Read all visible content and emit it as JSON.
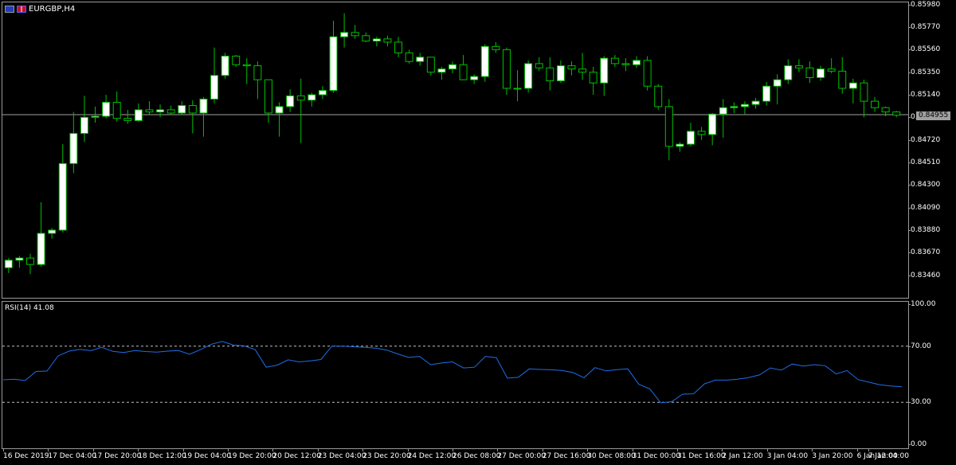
{
  "header": {
    "symbol_label": "EURGBP,H4",
    "flag_left_icon": "eu-flag-icon",
    "flag_right_icon": "gb-flag-icon"
  },
  "indicator": {
    "label": "RSI(14) 41.08"
  },
  "current_price": "0.84955",
  "price_scale": [
    "0.85980",
    "0.85770",
    "0.85560",
    "0.85350",
    "0.85140",
    "0.84930",
    "0.84720",
    "0.84510",
    "0.84300",
    "0.84090",
    "0.83880",
    "0.83670",
    "0.83460"
  ],
  "rsi_scale": [
    "100.00",
    "70.00",
    "30.00",
    "0.00"
  ],
  "time_axis": [
    "16 Dec 2019",
    "17 Dec 04:00",
    "17 Dec 20:00",
    "18 Dec 12:00",
    "19 Dec 04:00",
    "19 Dec 20:00",
    "20 Dec 12:00",
    "23 Dec 04:00",
    "23 Dec 20:00",
    "24 Dec 12:00",
    "26 Dec 08:00",
    "27 Dec 00:00",
    "27 Dec 16:00",
    "30 Dec 08:00",
    "31 Dec 00:00",
    "31 Dec 16:00",
    "2 Jan 12:00",
    "3 Jan 04:00",
    "3 Jan 20:00",
    "6 Jan 12:00",
    "7 Jan 04:00"
  ],
  "colors": {
    "bull_body": "#ffffff",
    "bear_body": "#000000",
    "wick": "#00c000",
    "rsi_line": "#1e6ee8",
    "level_line": "#c0c0c0",
    "price_line": "#a0a0a0"
  },
  "chart_data": [
    {
      "type": "candlestick",
      "symbol": "EURGBP",
      "timeframe": "H4",
      "ylim": [
        0.8325,
        0.86
      ],
      "current_price": 0.84955,
      "candles": [
        {
          "o": 0.8353,
          "h": 0.8362,
          "l": 0.8348,
          "c": 0.836
        },
        {
          "o": 0.836,
          "h": 0.8364,
          "l": 0.8353,
          "c": 0.8362
        },
        {
          "o": 0.8362,
          "h": 0.8366,
          "l": 0.8347,
          "c": 0.8356
        },
        {
          "o": 0.8356,
          "h": 0.8414,
          "l": 0.8354,
          "c": 0.8385
        },
        {
          "o": 0.8385,
          "h": 0.839,
          "l": 0.838,
          "c": 0.8388
        },
        {
          "o": 0.8388,
          "h": 0.8468,
          "l": 0.8386,
          "c": 0.845
        },
        {
          "o": 0.845,
          "h": 0.8498,
          "l": 0.8441,
          "c": 0.8478
        },
        {
          "o": 0.8478,
          "h": 0.8513,
          "l": 0.847,
          "c": 0.8493
        },
        {
          "o": 0.8493,
          "h": 0.8503,
          "l": 0.8488,
          "c": 0.8494
        },
        {
          "o": 0.8494,
          "h": 0.8514,
          "l": 0.8492,
          "c": 0.8507
        },
        {
          "o": 0.8507,
          "h": 0.8517,
          "l": 0.8489,
          "c": 0.8492
        },
        {
          "o": 0.8492,
          "h": 0.85,
          "l": 0.8487,
          "c": 0.849
        },
        {
          "o": 0.849,
          "h": 0.8506,
          "l": 0.8489,
          "c": 0.85
        },
        {
          "o": 0.85,
          "h": 0.8508,
          "l": 0.8496,
          "c": 0.8498
        },
        {
          "o": 0.8498,
          "h": 0.8505,
          "l": 0.8493,
          "c": 0.85
        },
        {
          "o": 0.85,
          "h": 0.8504,
          "l": 0.8495,
          "c": 0.8497
        },
        {
          "o": 0.8497,
          "h": 0.8508,
          "l": 0.8495,
          "c": 0.8504
        },
        {
          "o": 0.8504,
          "h": 0.8509,
          "l": 0.8478,
          "c": 0.8497
        },
        {
          "o": 0.8497,
          "h": 0.8512,
          "l": 0.8475,
          "c": 0.851
        },
        {
          "o": 0.851,
          "h": 0.8558,
          "l": 0.8506,
          "c": 0.8532
        },
        {
          "o": 0.8532,
          "h": 0.8553,
          "l": 0.8529,
          "c": 0.855
        },
        {
          "o": 0.855,
          "h": 0.8551,
          "l": 0.854,
          "c": 0.8542
        },
        {
          "o": 0.8542,
          "h": 0.8548,
          "l": 0.8524,
          "c": 0.8541
        },
        {
          "o": 0.8541,
          "h": 0.8545,
          "l": 0.851,
          "c": 0.8528
        },
        {
          "o": 0.8528,
          "h": 0.8528,
          "l": 0.8488,
          "c": 0.8497
        },
        {
          "o": 0.8497,
          "h": 0.8507,
          "l": 0.8475,
          "c": 0.8503
        },
        {
          "o": 0.8503,
          "h": 0.8519,
          "l": 0.8498,
          "c": 0.8513
        },
        {
          "o": 0.8513,
          "h": 0.8529,
          "l": 0.8469,
          "c": 0.8509
        },
        {
          "o": 0.8509,
          "h": 0.8516,
          "l": 0.8503,
          "c": 0.8514
        },
        {
          "o": 0.8514,
          "h": 0.8522,
          "l": 0.851,
          "c": 0.8518
        },
        {
          "o": 0.8518,
          "h": 0.8583,
          "l": 0.8516,
          "c": 0.8568
        },
        {
          "o": 0.8568,
          "h": 0.859,
          "l": 0.8558,
          "c": 0.8572
        },
        {
          "o": 0.8572,
          "h": 0.8579,
          "l": 0.8566,
          "c": 0.8569
        },
        {
          "o": 0.8569,
          "h": 0.8572,
          "l": 0.8563,
          "c": 0.8564
        },
        {
          "o": 0.8564,
          "h": 0.8568,
          "l": 0.8559,
          "c": 0.8566
        },
        {
          "o": 0.8566,
          "h": 0.8569,
          "l": 0.8559,
          "c": 0.8563
        },
        {
          "o": 0.8563,
          "h": 0.8568,
          "l": 0.8549,
          "c": 0.8553
        },
        {
          "o": 0.8553,
          "h": 0.8556,
          "l": 0.8543,
          "c": 0.8545
        },
        {
          "o": 0.8545,
          "h": 0.8553,
          "l": 0.8541,
          "c": 0.8549
        },
        {
          "o": 0.8549,
          "h": 0.8537,
          "l": 0.8532,
          "c": 0.8535
        },
        {
          "o": 0.8535,
          "h": 0.854,
          "l": 0.8528,
          "c": 0.8538
        },
        {
          "o": 0.8538,
          "h": 0.8545,
          "l": 0.8534,
          "c": 0.8542
        },
        {
          "o": 0.8542,
          "h": 0.8551,
          "l": 0.8532,
          "c": 0.8528
        },
        {
          "o": 0.8528,
          "h": 0.8533,
          "l": 0.8524,
          "c": 0.8531
        },
        {
          "o": 0.8531,
          "h": 0.8561,
          "l": 0.8526,
          "c": 0.8559
        },
        {
          "o": 0.8559,
          "h": 0.8563,
          "l": 0.8553,
          "c": 0.8556
        },
        {
          "o": 0.8556,
          "h": 0.8558,
          "l": 0.8514,
          "c": 0.852
        },
        {
          "o": 0.852,
          "h": 0.8537,
          "l": 0.8508,
          "c": 0.852
        },
        {
          "o": 0.852,
          "h": 0.8546,
          "l": 0.8516,
          "c": 0.8543
        },
        {
          "o": 0.8543,
          "h": 0.8549,
          "l": 0.8536,
          "c": 0.8539
        },
        {
          "o": 0.8539,
          "h": 0.8549,
          "l": 0.8518,
          "c": 0.8527
        },
        {
          "o": 0.8527,
          "h": 0.8546,
          "l": 0.8525,
          "c": 0.8541
        },
        {
          "o": 0.8541,
          "h": 0.8545,
          "l": 0.8532,
          "c": 0.8538
        },
        {
          "o": 0.8538,
          "h": 0.8553,
          "l": 0.8528,
          "c": 0.8535
        },
        {
          "o": 0.8535,
          "h": 0.854,
          "l": 0.8514,
          "c": 0.8525
        },
        {
          "o": 0.8525,
          "h": 0.855,
          "l": 0.8513,
          "c": 0.8548
        },
        {
          "o": 0.8548,
          "h": 0.8551,
          "l": 0.854,
          "c": 0.8543
        },
        {
          "o": 0.8543,
          "h": 0.8548,
          "l": 0.8536,
          "c": 0.8542
        },
        {
          "o": 0.8542,
          "h": 0.855,
          "l": 0.8539,
          "c": 0.8546
        },
        {
          "o": 0.8546,
          "h": 0.855,
          "l": 0.8518,
          "c": 0.8522
        },
        {
          "o": 0.8522,
          "h": 0.8524,
          "l": 0.85,
          "c": 0.8503
        },
        {
          "o": 0.8503,
          "h": 0.851,
          "l": 0.8453,
          "c": 0.8466
        },
        {
          "o": 0.8466,
          "h": 0.847,
          "l": 0.8461,
          "c": 0.8468
        },
        {
          "o": 0.8468,
          "h": 0.8488,
          "l": 0.8466,
          "c": 0.848
        },
        {
          "o": 0.848,
          "h": 0.8484,
          "l": 0.8472,
          "c": 0.8477
        },
        {
          "o": 0.8477,
          "h": 0.8497,
          "l": 0.8467,
          "c": 0.8496
        },
        {
          "o": 0.8496,
          "h": 0.851,
          "l": 0.8474,
          "c": 0.8502
        },
        {
          "o": 0.8502,
          "h": 0.8507,
          "l": 0.8497,
          "c": 0.8503
        },
        {
          "o": 0.8503,
          "h": 0.8508,
          "l": 0.8496,
          "c": 0.8505
        },
        {
          "o": 0.8505,
          "h": 0.8511,
          "l": 0.8501,
          "c": 0.8508
        },
        {
          "o": 0.8508,
          "h": 0.8526,
          "l": 0.8504,
          "c": 0.8522
        },
        {
          "o": 0.8522,
          "h": 0.8533,
          "l": 0.8505,
          "c": 0.8528
        },
        {
          "o": 0.8528,
          "h": 0.8547,
          "l": 0.8524,
          "c": 0.8541
        },
        {
          "o": 0.8541,
          "h": 0.8547,
          "l": 0.8535,
          "c": 0.8539
        },
        {
          "o": 0.8539,
          "h": 0.8545,
          "l": 0.8525,
          "c": 0.853
        },
        {
          "o": 0.853,
          "h": 0.8541,
          "l": 0.8527,
          "c": 0.8538
        },
        {
          "o": 0.8538,
          "h": 0.8548,
          "l": 0.8534,
          "c": 0.8536
        },
        {
          "o": 0.8536,
          "h": 0.8549,
          "l": 0.8515,
          "c": 0.852
        },
        {
          "o": 0.852,
          "h": 0.8529,
          "l": 0.8506,
          "c": 0.8525
        },
        {
          "o": 0.8525,
          "h": 0.8528,
          "l": 0.8493,
          "c": 0.8508
        },
        {
          "o": 0.8508,
          "h": 0.8512,
          "l": 0.8498,
          "c": 0.8502
        },
        {
          "o": 0.8502,
          "h": 0.8503,
          "l": 0.8494,
          "c": 0.8498
        },
        {
          "o": 0.8498,
          "h": 0.8499,
          "l": 0.8493,
          "c": 0.8495
        }
      ]
    },
    {
      "type": "line",
      "name": "RSI(14)",
      "ylim": [
        0,
        100
      ],
      "levels": [
        70,
        30
      ],
      "values": [
        46,
        46.5,
        45.5,
        52,
        52.3,
        63,
        66.5,
        67.8,
        66.8,
        69.2,
        66.3,
        65.5,
        66.9,
        66.2,
        65.8,
        66.5,
        66.9,
        64.3,
        67.5,
        71.4,
        73.4,
        70.8,
        70.2,
        67.5,
        55,
        56.5,
        60.3,
        58.8,
        59.5,
        60.5,
        70.1,
        70,
        69.6,
        69.2,
        68.6,
        67.2,
        64.5,
        62,
        62.7,
        56.8,
        58,
        58.8,
        54.5,
        55,
        62.7,
        61.8,
        47.2,
        47.8,
        53.8,
        53.4,
        53.2,
        52.6,
        51.2,
        47.5,
        54.7,
        52.4,
        53.3,
        53.8,
        42.8,
        39.6,
        29.6,
        30.4,
        35.8,
        36,
        43.2,
        45.8,
        45.8,
        46.4,
        47.6,
        49.5,
        54.5,
        52.9,
        57.3,
        55.8,
        56.8,
        56.1,
        50.2,
        52.6,
        46.2,
        44.3,
        42.5,
        41.6,
        41.1
      ]
    }
  ]
}
